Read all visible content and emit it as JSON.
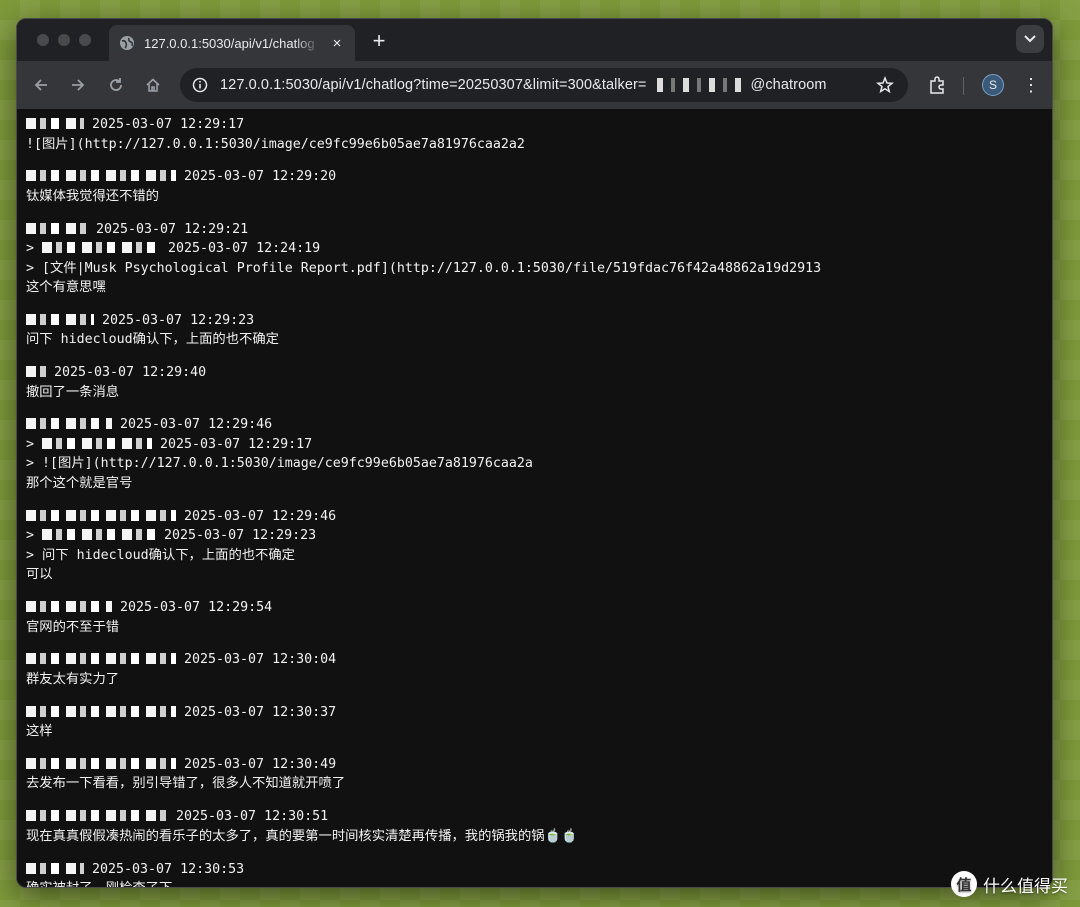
{
  "tab": {
    "title": "127.0.0.1:5030/api/v1/chatlog",
    "close_icon": "×",
    "new_tab_icon": "+"
  },
  "omnibox": {
    "url_prefix": "127.0.0.1:5030/api/v1/chatlog?time=20250307&limit=300&talker=",
    "url_suffix": "@chatroom"
  },
  "profile": {
    "avatar_letter": "S"
  },
  "messages": [
    {
      "header": "2025-03-07 12:29:17",
      "lines": [
        "![图片](http://127.0.0.1:5030/image/ce9fc99e6b05ae7a81976caa2a2"
      ]
    },
    {
      "header": "2025-03-07 12:29:20",
      "lines": [
        "钛媒体我觉得还不错的"
      ]
    },
    {
      "header": "2025-03-07 12:29:21",
      "lines": [
        {
          "quote_header": "2025-03-07 12:24:19"
        },
        "> [文件|Musk Psychological Profile Report.pdf](http://127.0.0.1:5030/file/519fdac76f42a48862a19d2913",
        "这个有意思嘿"
      ]
    },
    {
      "header": "2025-03-07 12:29:23",
      "lines": [
        "问下 hidecloud确认下，上面的也不确定"
      ]
    },
    {
      "header": "2025-03-07 12:29:40",
      "lines": [
        "撤回了一条消息"
      ]
    },
    {
      "header": "2025-03-07 12:29:46",
      "lines": [
        {
          "quote_header": "2025-03-07 12:29:17"
        },
        "> ![图片](http://127.0.0.1:5030/image/ce9fc99e6b05ae7a81976caa2a",
        "那个这个就是官号"
      ]
    },
    {
      "header": "2025-03-07 12:29:46",
      "lines": [
        {
          "quote_header": "2025-03-07 12:29:23"
        },
        "> 问下 hidecloud确认下，上面的也不确定",
        "可以"
      ]
    },
    {
      "header": "2025-03-07 12:29:54",
      "lines": [
        "官网的不至于错"
      ]
    },
    {
      "header": "2025-03-07 12:30:04",
      "lines": [
        "群友太有实力了"
      ]
    },
    {
      "header": "2025-03-07 12:30:37",
      "lines": [
        "这样"
      ]
    },
    {
      "header": "2025-03-07 12:30:49",
      "lines": [
        "去发布一下看看，别引导错了，很多人不知道就开喷了"
      ]
    },
    {
      "header": "2025-03-07 12:30:51",
      "lines": [
        "现在真真假假凑热闹的看乐子的太多了，真的要第一时间核实清楚再传播，我的锅我的锅🍵🍵"
      ]
    },
    {
      "header": "2025-03-07 12:30:53",
      "lines": [
        "确实被封了，刚检查了下"
      ]
    }
  ],
  "watermark": {
    "text": "什么值得买",
    "logo": "值"
  }
}
